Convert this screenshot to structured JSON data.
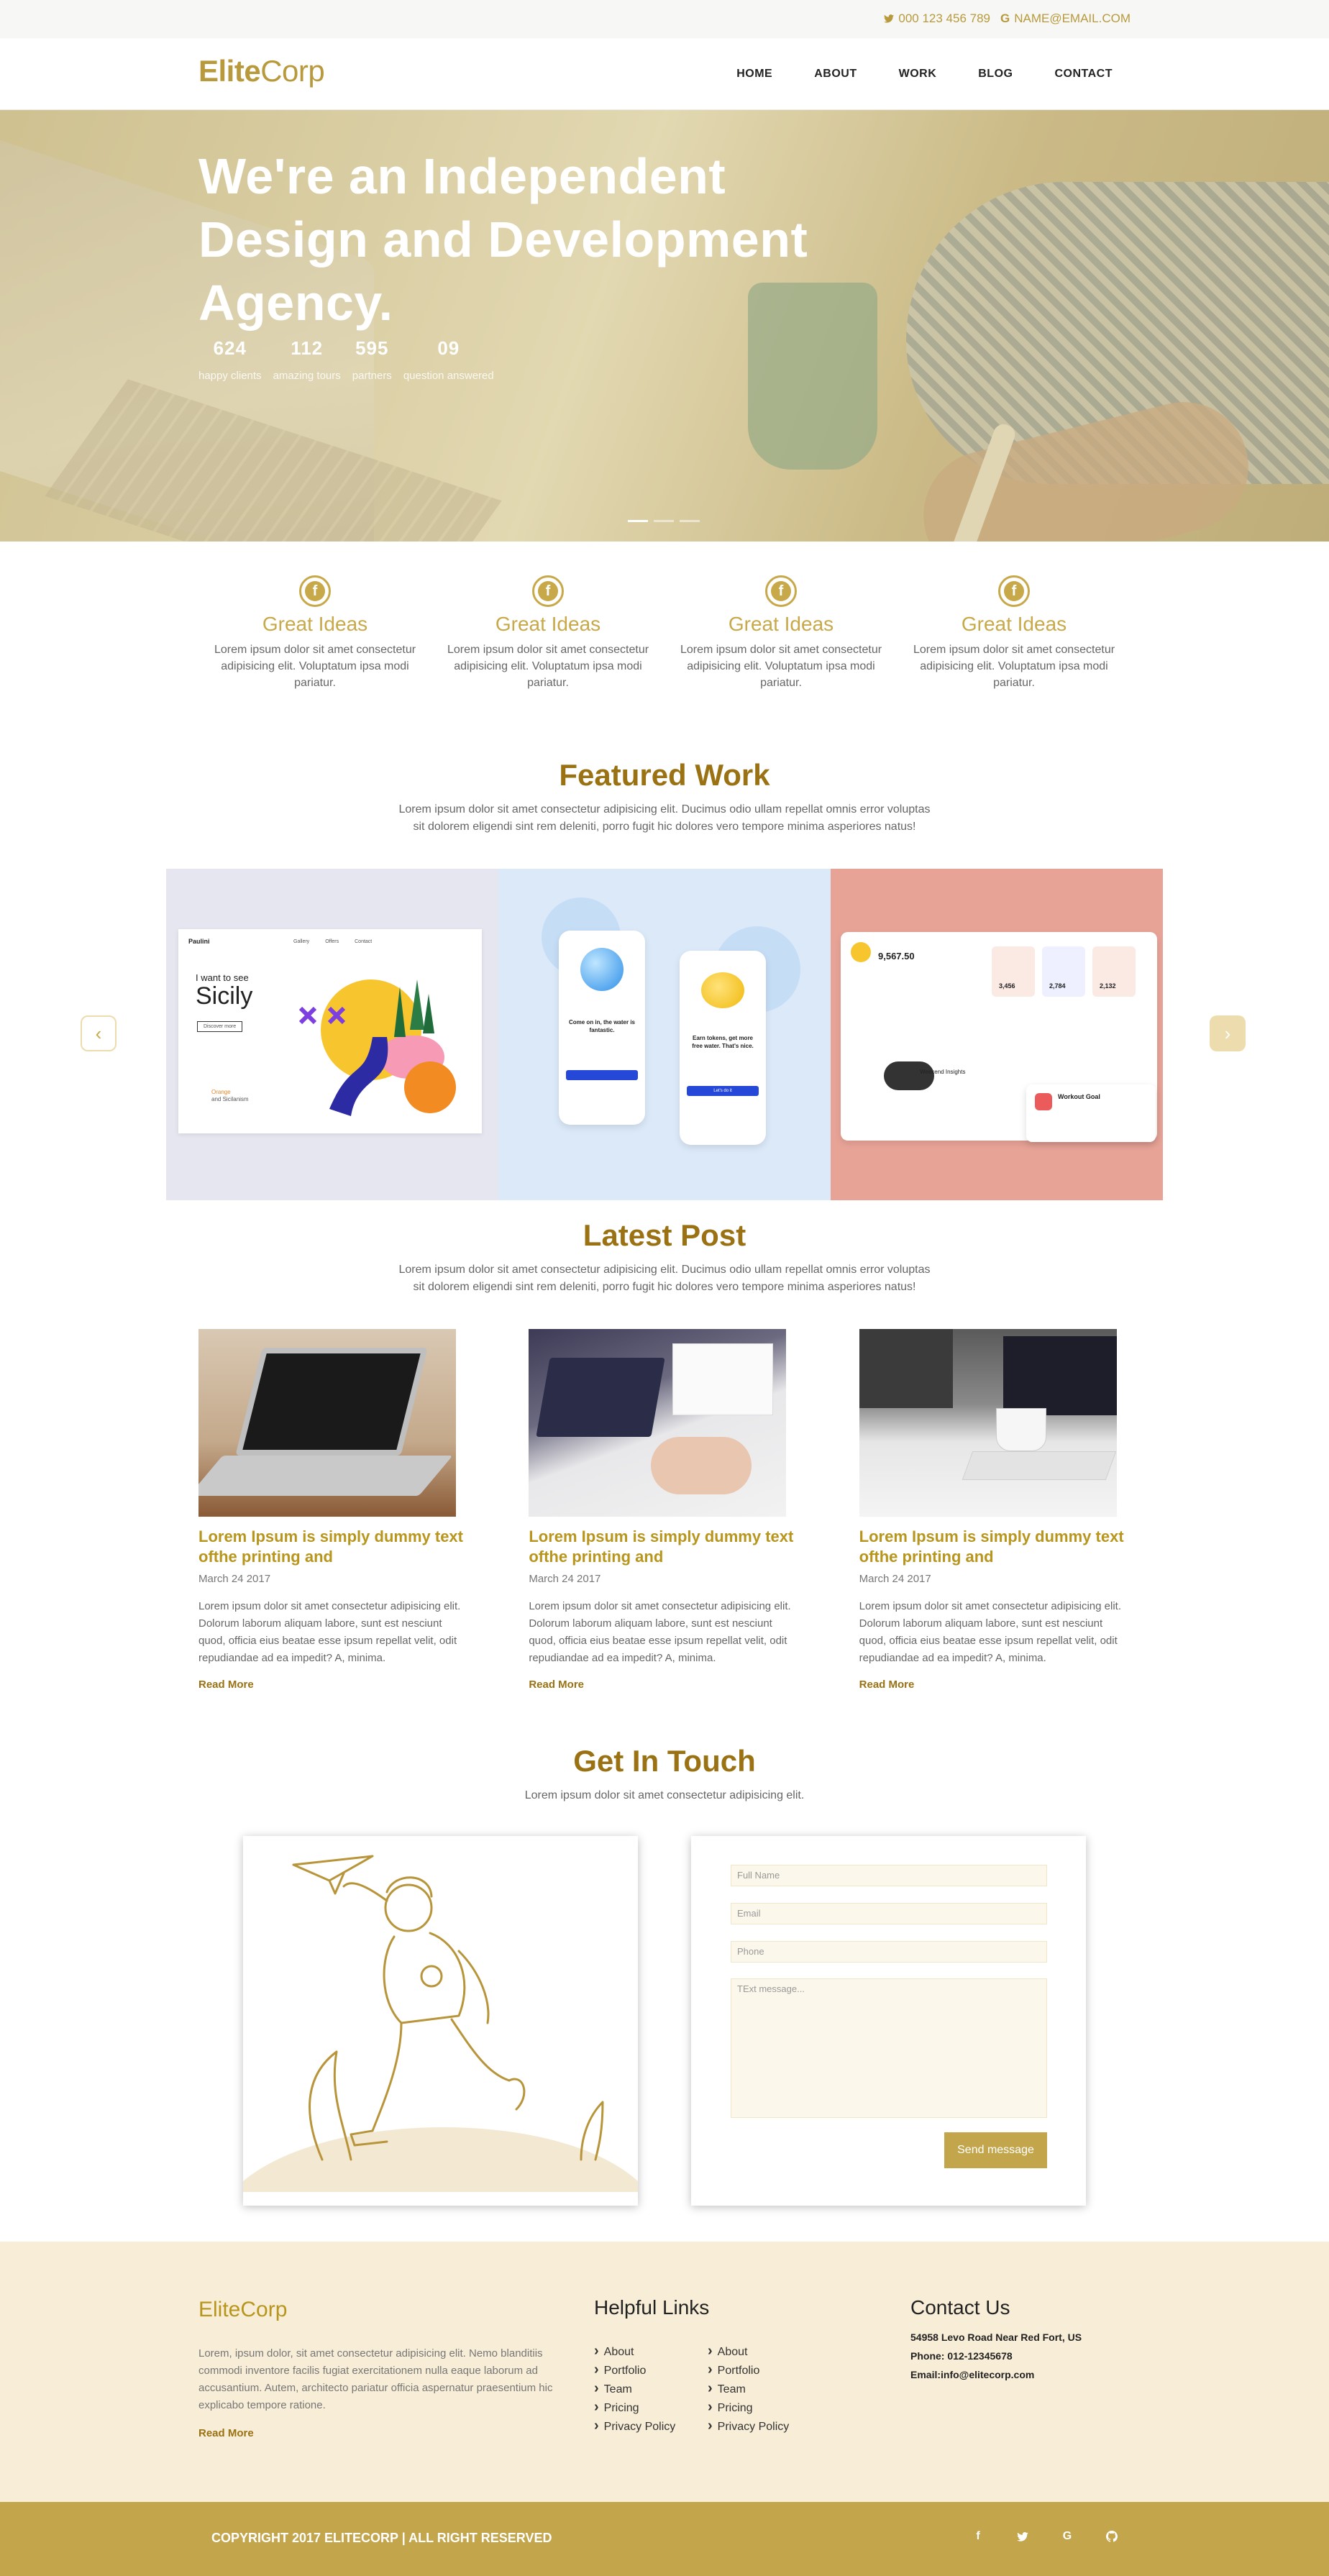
{
  "topbar": {
    "phone": "000 123 456 789",
    "email": "NAME@EMAIL.COM"
  },
  "brand": {
    "name_a": "Elite",
    "name_b": "Corp"
  },
  "nav": [
    "HOME",
    "ABOUT",
    "WORK",
    "BLOG",
    "CONTACT"
  ],
  "hero": {
    "title": "We're an Independent Design and Development Agency.",
    "stats": [
      {
        "num": "624",
        "label": "happy clients"
      },
      {
        "num": "112",
        "label": "amazing tours"
      },
      {
        "num": "595",
        "label": "partners"
      },
      {
        "num": "09",
        "label": "question answered"
      }
    ]
  },
  "features": [
    {
      "title": "Great Ideas",
      "text": "Lorem ipsum dolor sit amet consectetur adipisicing elit. Voluptatum ipsa modi pariatur."
    },
    {
      "title": "Great Ideas",
      "text": "Lorem ipsum dolor sit amet consectetur adipisicing elit. Voluptatum ipsa modi pariatur."
    },
    {
      "title": "Great Ideas",
      "text": "Lorem ipsum dolor sit amet consectetur adipisicing elit. Voluptatum ipsa modi pariatur."
    },
    {
      "title": "Great Ideas",
      "text": "Lorem ipsum dolor sit amet consectetur adipisicing elit. Voluptatum ipsa modi pariatur."
    }
  ],
  "featured": {
    "title": "Featured Work",
    "sub1": "Lorem ipsum dolor sit amet consectetur adipisicing elit. Ducimus odio ullam repellat omnis error voluptas",
    "sub2": "sit dolorem eligendi sint rem deleniti, porro fugit hic dolores vero tempore minima asperiores natus!",
    "work1": {
      "brand": "Paulini",
      "menu": [
        "Gallery",
        "Offers",
        "Contact"
      ],
      "headline": "I want to see",
      "city": "Sicily",
      "btn": "Discover more",
      "sidebar_a": "Orange",
      "sidebar_b": "and Sicilanism"
    },
    "work2": {
      "card1_title": "Come on in, the water is fantastic.",
      "card2_title": "Earn tokens, get more free water. That's nice.",
      "btn": "Let's do it"
    },
    "work3": {
      "amount": "9,567.50",
      "n1": "3,456",
      "n2": "2,784",
      "n3": "2,132",
      "card_a": "Weekend Insights",
      "card_b": "Workout Goal"
    }
  },
  "latest": {
    "title": "Latest Post",
    "sub1": "Lorem ipsum dolor sit amet consectetur adipisicing elit. Ducimus odio ullam repellat omnis error voluptas",
    "sub2": "sit dolorem eligendi sint rem deleniti, porro fugit hic dolores vero tempore minima asperiores natus!",
    "posts": [
      {
        "title": "Lorem Ipsum is simply dummy text ofthe printing and",
        "date": "March 24 2017",
        "body": "Lorem ipsum dolor sit amet consectetur adipisicing elit. Dolorum laborum aliquam labore, sunt est nesciunt quod, officia eius beatae esse ipsum repellat velit, odit repudiandae ad ea impedit? A, minima.",
        "more": "Read More"
      },
      {
        "title": "Lorem Ipsum is simply dummy text ofthe printing and",
        "date": "March 24 2017",
        "body": "Lorem ipsum dolor sit amet consectetur adipisicing elit. Dolorum laborum aliquam labore, sunt est nesciunt quod, officia eius beatae esse ipsum repellat velit, odit repudiandae ad ea impedit? A, minima.",
        "more": "Read More"
      },
      {
        "title": "Lorem Ipsum is simply dummy text ofthe printing and",
        "date": "March 24 2017",
        "body": "Lorem ipsum dolor sit amet consectetur adipisicing elit. Dolorum laborum aliquam labore, sunt est nesciunt quod, officia eius beatae esse ipsum repellat velit, odit repudiandae ad ea impedit? A, minima.",
        "more": "Read More"
      }
    ]
  },
  "contact": {
    "title": "Get In Touch",
    "sub": "Lorem ipsum dolor sit amet consectetur adipisicing elit.",
    "fullname_ph": "Full Name",
    "email_ph": "Email",
    "phone_ph": "Phone",
    "message_ph": "TExt message...",
    "send": "Send message"
  },
  "footer": {
    "brand": "EliteCorp",
    "about": "Lorem, ipsum dolor, sit amet consectetur adipisicing elit. Nemo blanditiis commodi inventore facilis fugiat exercitationem nulla eaque laborum ad accusantium. Autem, architecto pariatur officia aspernatur praesentium hic explicabo tempore ratione.",
    "more": "Read More",
    "links_title": "Helpful Links",
    "links_a": [
      "About",
      "Portfolio",
      "Team",
      "Pricing",
      "Privacy Policy"
    ],
    "links_b": [
      "About",
      "Portfolio",
      "Team",
      "Pricing",
      "Privacy Policy"
    ],
    "contact_title": "Contact Us",
    "address": "54958 Levo Road Near Red Fort, US",
    "phone": "Phone: 012-12345678",
    "email": "Email:info@elitecorp.com",
    "copyright": "COPYRIGHT 2017 ELITECORP | ALL RIGHT RESERVED"
  },
  "colors": {
    "accent": "#c3a54c",
    "title": "#9a7214",
    "footer_bg": "#f8edd6"
  },
  "icons": {
    "phone": "twitter-icon",
    "email": "google-icon",
    "social": [
      "facebook-icon",
      "twitter-icon",
      "google-icon",
      "github-icon"
    ]
  }
}
